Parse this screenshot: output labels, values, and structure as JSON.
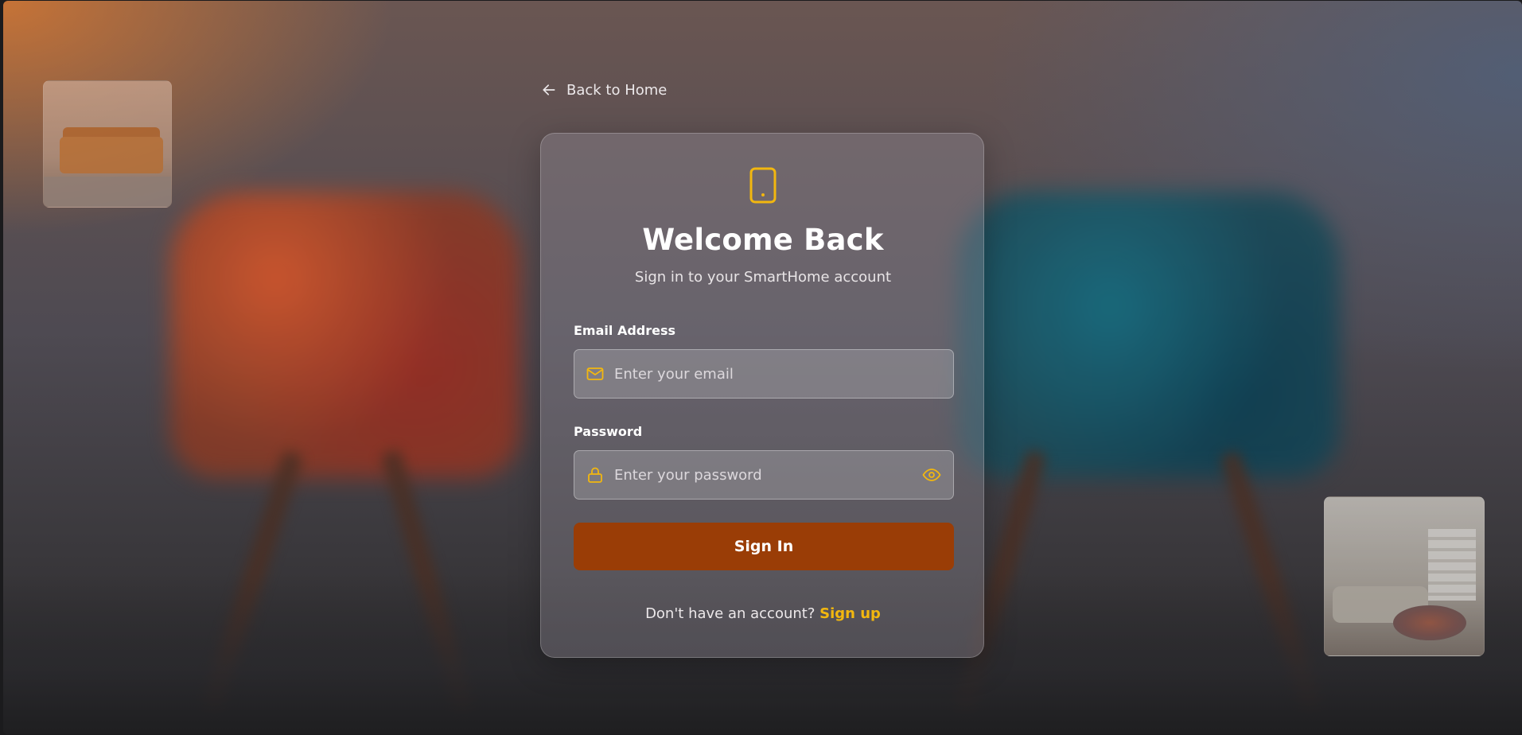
{
  "back_link": {
    "label": "Back to Home",
    "icon": "arrow-left-icon"
  },
  "card": {
    "icon": "device-tablet-icon",
    "title": "Welcome Back",
    "subtitle": "Sign in to your SmartHome account"
  },
  "form": {
    "email": {
      "label": "Email Address",
      "placeholder": "Enter your email",
      "value": "",
      "icon": "mail-icon"
    },
    "password": {
      "label": "Password",
      "placeholder": "Enter your password",
      "value": "",
      "icon": "lock-icon",
      "toggle_icon": "eye-icon"
    },
    "submit_label": "Sign In"
  },
  "signup": {
    "prompt": "Don't have an account?",
    "link_label": "Sign up"
  },
  "colors": {
    "accent": "#f2b70f",
    "button": "#9a3d06"
  },
  "background": {
    "images": [
      "sofa-thumbnail",
      "living-room-thumbnail"
    ]
  }
}
